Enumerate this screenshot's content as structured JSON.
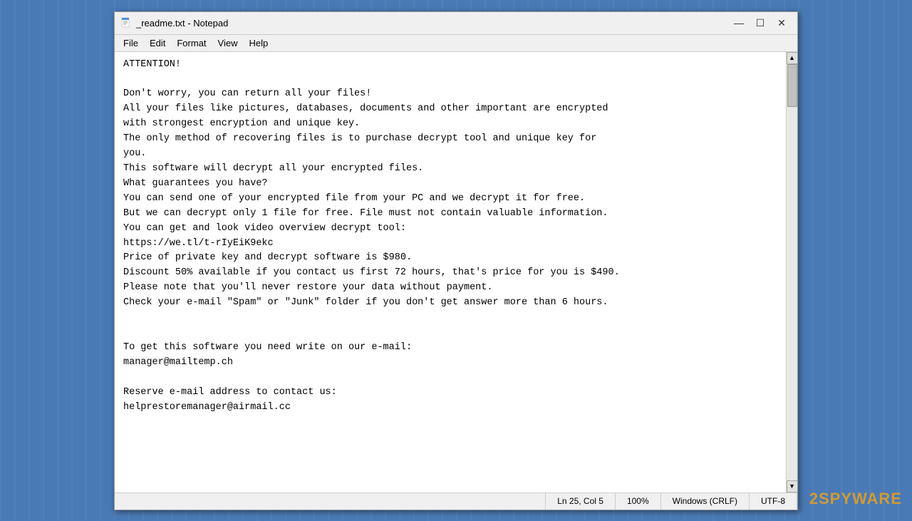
{
  "window": {
    "title": "_readme.txt - Notepad",
    "icon_text": "📄"
  },
  "titlebar": {
    "minimize_label": "—",
    "maximize_label": "☐",
    "close_label": "✕"
  },
  "menubar": {
    "items": [
      {
        "id": "file",
        "label": "File"
      },
      {
        "id": "edit",
        "label": "Edit"
      },
      {
        "id": "format",
        "label": "Format"
      },
      {
        "id": "view",
        "label": "View"
      },
      {
        "id": "help",
        "label": "Help"
      }
    ]
  },
  "editor": {
    "content": "ATTENTION!\n\nDon't worry, you can return all your files!\nAll your files like pictures, databases, documents and other important are encrypted\nwith strongest encryption and unique key.\nThe only method of recovering files is to purchase decrypt tool and unique key for\nyou.\nThis software will decrypt all your encrypted files.\nWhat guarantees you have?\nYou can send one of your encrypted file from your PC and we decrypt it for free.\nBut we can decrypt only 1 file for free. File must not contain valuable information.\nYou can get and look video overview decrypt tool:\nhttps://we.tl/t-rIyEiK9ekc\nPrice of private key and decrypt software is $980.\nDiscount 50% available if you contact us first 72 hours, that's price for you is $490.\nPlease note that you'll never restore your data without payment.\nCheck your e-mail \"Spam\" or \"Junk\" folder if you don't get answer more than 6 hours.\n\n\nTo get this software you need write on our e-mail:\nmanager@mailtemp.ch\n\nReserve e-mail address to contact us:\nhelprestoremanager@airmail.cc\n"
  },
  "statusbar": {
    "position": "Ln 25, Col 5",
    "zoom": "100%",
    "line_ending": "Windows (CRLF)",
    "encoding": "UTF-8"
  },
  "watermark": {
    "prefix": "2",
    "suffix_highlight": "SPYWARE"
  },
  "background": {
    "color": "#4a7ab5"
  }
}
